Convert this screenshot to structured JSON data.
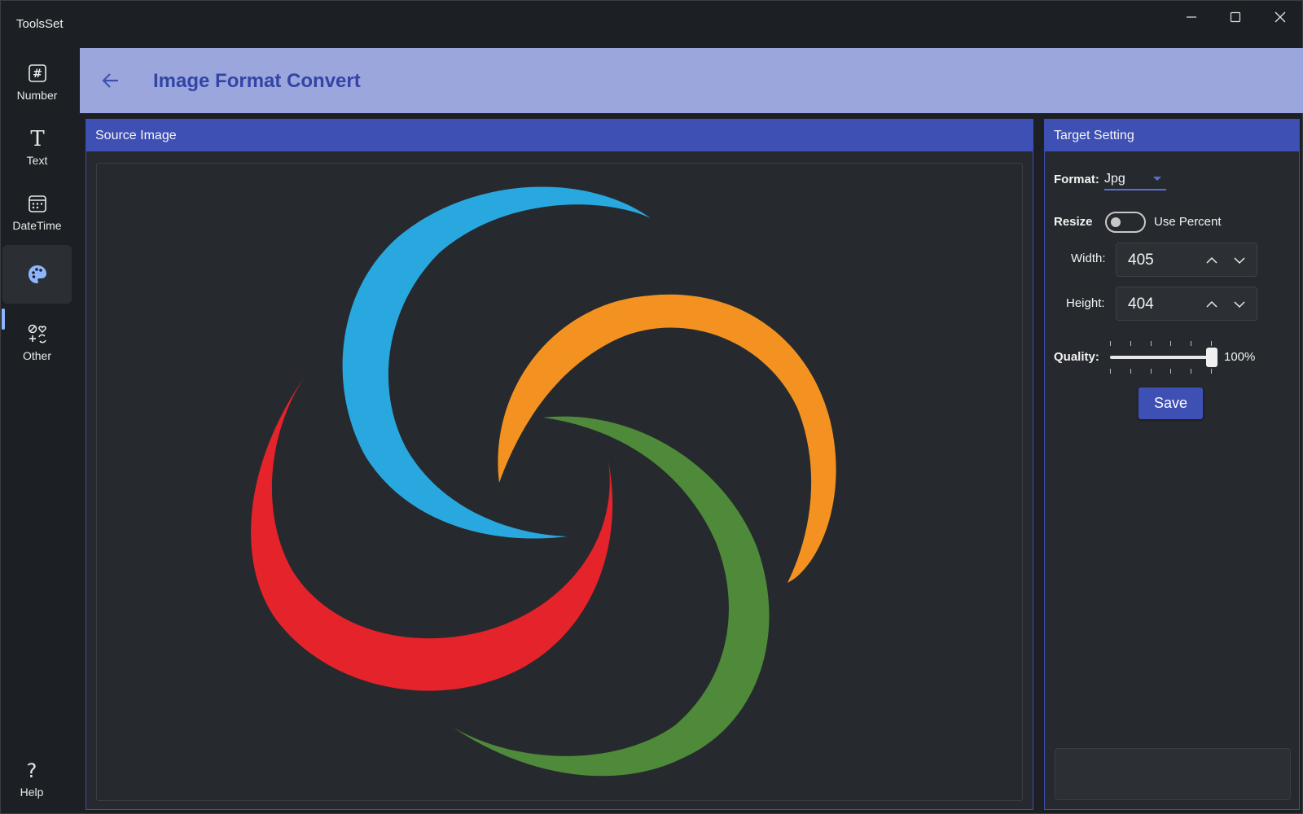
{
  "window": {
    "title": "ToolsSet"
  },
  "sidebar": {
    "items": [
      {
        "label": "Number",
        "icon": "hash-icon"
      },
      {
        "label": "Text",
        "icon": "text-icon"
      },
      {
        "label": "DateTime",
        "icon": "calendar-icon"
      },
      {
        "label": "",
        "icon": "palette-icon",
        "active": true
      },
      {
        "label": "Other",
        "icon": "other-tools-icon"
      }
    ],
    "help_label": "Help"
  },
  "header": {
    "title": "Image Format Convert",
    "background": "#9ba7dc",
    "title_color": "#3344a5"
  },
  "source": {
    "title": "Source Image"
  },
  "target": {
    "title": "Target Setting",
    "format_label": "Format:",
    "format_value": "Jpg",
    "resize_label": "Resize",
    "use_percent_label": "Use Percent",
    "use_percent_on": false,
    "width_label": "Width:",
    "width_value": "405",
    "height_label": "Height:",
    "height_value": "404",
    "quality_label": "Quality:",
    "quality_value": "100%",
    "quality_fraction": 1.0,
    "save_label": "Save"
  },
  "colors": {
    "accent": "#3f50b5",
    "swirl_blue": "#29a8e0",
    "swirl_orange": "#f39220",
    "swirl_green": "#4e8a3a",
    "swirl_red": "#e4232a"
  }
}
